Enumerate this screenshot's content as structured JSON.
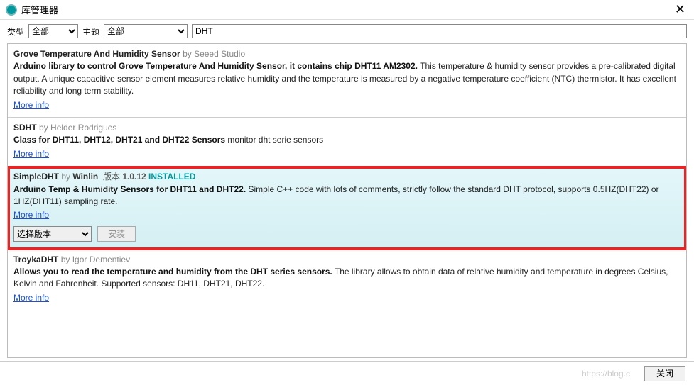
{
  "window": {
    "title": "库管理器"
  },
  "filters": {
    "type_label": "类型",
    "type_value": "全部",
    "topic_label": "主题",
    "topic_value": "全部",
    "search_value": "DHT"
  },
  "libraries": [
    {
      "name": "Grove Temperature And Humidity Sensor",
      "author": "Seeed Studio",
      "desc_bold": "Arduino library to control Grove Temperature And Humidity Sensor, it contains chip DHT11 AM2302.",
      "desc_rest": " This temperature & humidity sensor provides a pre-calibrated digital output. A unique capacitive sensor element measures relative humidity and the temperature is measured by a negative temperature coefficient (NTC) thermistor. It has excellent reliability and long term stability.",
      "more": "More info"
    },
    {
      "name": "SDHT",
      "author": "Helder Rodrigues",
      "desc_bold": "Class for DHT11, DHT12, DHT21 and DHT22 Sensors",
      "desc_rest": " monitor dht serie sensors",
      "more": "More info"
    },
    {
      "name": "SimpleDHT",
      "author": "Winlin",
      "version_label": "版本",
      "version": "1.0.12",
      "installed": "INSTALLED",
      "desc_bold": "Arduino Temp & Humidity Sensors for DHT11 and DHT22.",
      "desc_rest": " Simple C++ code with lots of comments, strictly follow the standard DHT protocol, supports 0.5HZ(DHT22) or 1HZ(DHT11) sampling rate.",
      "more": "More info",
      "select_placeholder": "选择版本",
      "install_label": "安装"
    },
    {
      "name": "TroykaDHT",
      "author": "Igor Dementiev",
      "desc_bold": "Allows you to read the temperature and humidity from the DHT series sensors.",
      "desc_rest": " The library allows to obtain data of relative humidity and temperature in degrees Celsius, Kelvin and Fahrenheit. Supported sensors: DH11, DHT21, DHT22.",
      "more": "More info"
    }
  ],
  "footer": {
    "watermark": "https://blog.c",
    "close_label": "关闭"
  }
}
